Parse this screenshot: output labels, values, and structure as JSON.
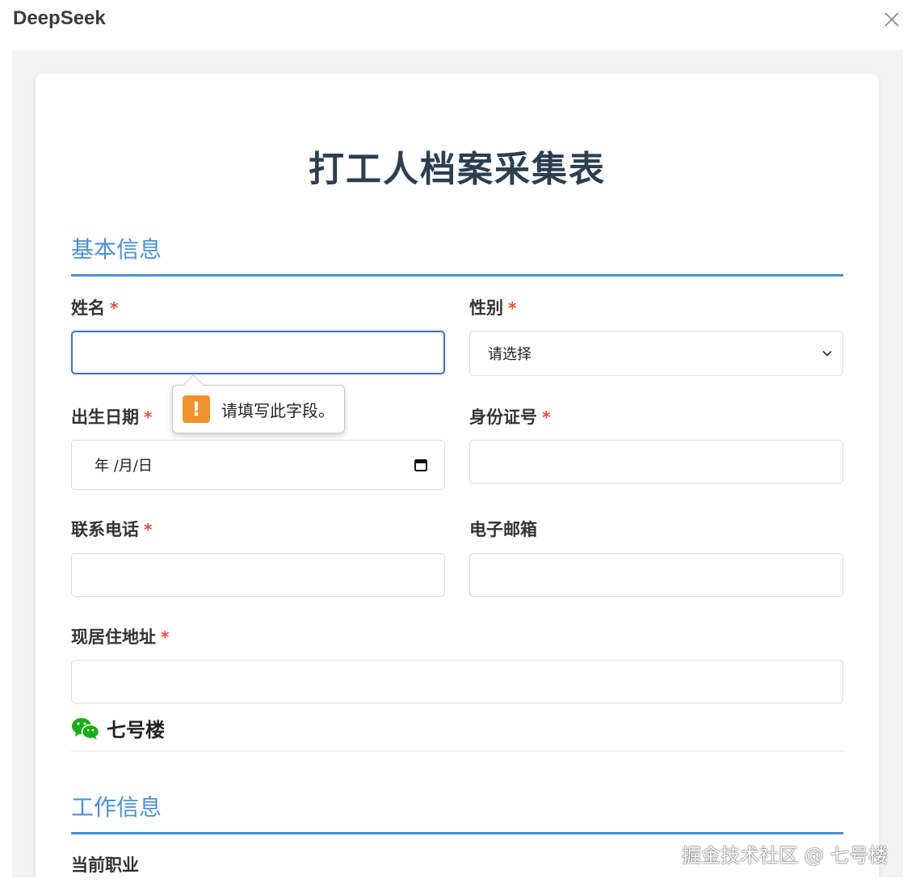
{
  "app": {
    "title": "DeepSeek"
  },
  "form": {
    "title": "打工人档案采集表",
    "required_mark": "*",
    "sections": {
      "basic": "基本信息",
      "work": "工作信息"
    },
    "fields": {
      "name": {
        "label": "姓名",
        "value": ""
      },
      "gender": {
        "label": "性别",
        "selected": "请选择"
      },
      "birthdate": {
        "label": "出生日期",
        "display": "年 /月/日"
      },
      "id_number": {
        "label": "身份证号",
        "value": ""
      },
      "phone": {
        "label": "联系电话",
        "value": ""
      },
      "email": {
        "label": "电子邮箱",
        "value": ""
      },
      "address": {
        "label": "现居住地址",
        "value": ""
      },
      "occupation": {
        "label": "当前职业"
      }
    },
    "validation_tooltip": "请填写此字段。"
  },
  "wechat": {
    "icon": "wechat-icon",
    "name": "七号楼"
  },
  "watermark": "掘金技术社区 @ 七号楼",
  "colors": {
    "accent": "#4a90d9",
    "required": "#e74c3c",
    "warning": "#f0922b",
    "wechat": "#1aad19",
    "title": "#2c3e50"
  }
}
